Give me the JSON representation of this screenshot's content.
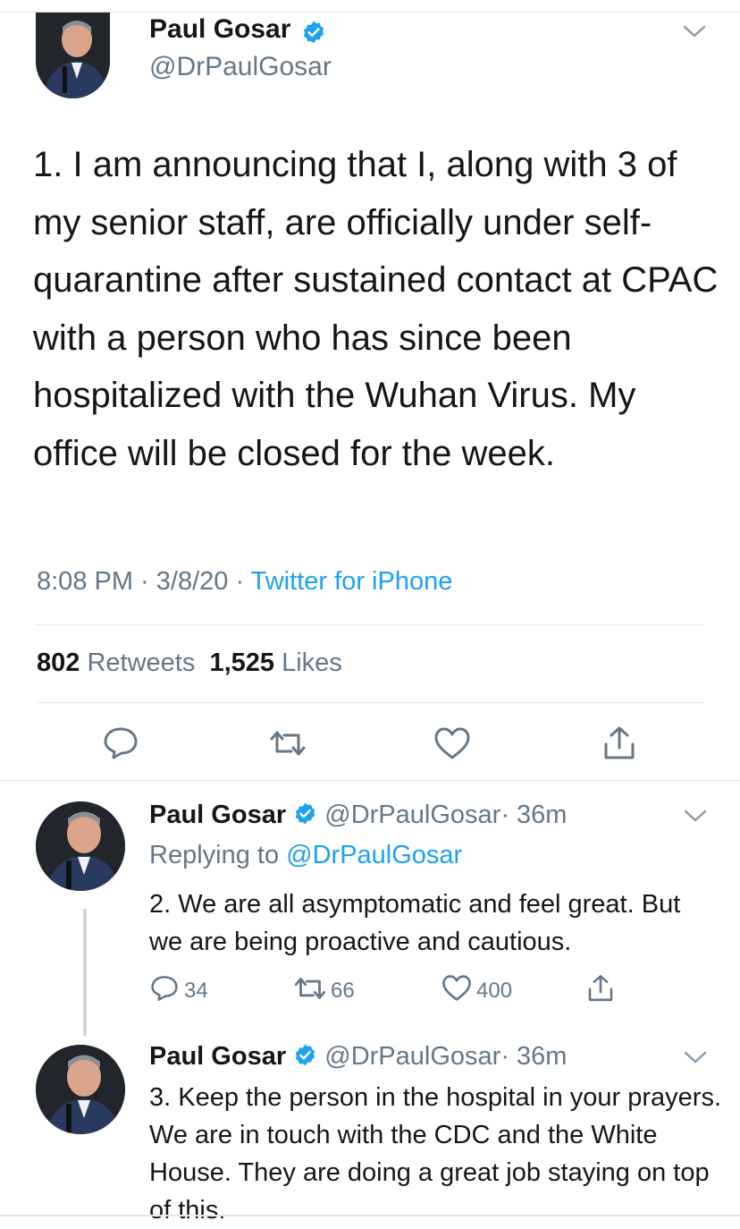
{
  "main_tweet": {
    "author_name": "Paul Gosar",
    "handle": "@DrPaulGosar",
    "text": "1. I am announcing that I, along with 3 of my senior staff, are officially under self-quarantine after sustained contact at CPAC with a person who has since been hospitalized with the Wuhan Virus.  My office will be closed for the week.",
    "time": "8:08 PM",
    "date": "3/8/20",
    "separator": " · ",
    "source": "Twitter for iPhone",
    "retweets_count": "802",
    "retweets_label": "Retweets",
    "likes_count": "1,525",
    "likes_label": "Likes"
  },
  "replies": [
    {
      "author_name": "Paul Gosar",
      "handle": "@DrPaulGosar",
      "age": "· 36m",
      "replying_to_label": "Replying to",
      "replying_to_handle": "@DrPaulGosar",
      "text": "2. We are all asymptomatic and feel great. But we are being proactive and cautious.",
      "reply_count": "34",
      "retweet_count": "66",
      "like_count": "400"
    },
    {
      "author_name": "Paul Gosar",
      "handle": "@DrPaulGosar",
      "age": "· 36m",
      "text": "3.  Keep the person in the hospital in your prayers.  We are in touch with the CDC and the White House.  They are doing a great job staying on top of this."
    }
  ],
  "colors": {
    "accent": "#1da1f2",
    "text": "#14171a",
    "muted": "#657786",
    "divider": "#e1e8ed",
    "verified": "#1da1f2"
  },
  "icons": {
    "verified": "verified-badge-icon",
    "menu": "chevron-down-icon",
    "reply": "speech-bubble-icon",
    "retweet": "retweet-arrows-icon",
    "like": "heart-icon",
    "share": "share-upload-icon"
  }
}
